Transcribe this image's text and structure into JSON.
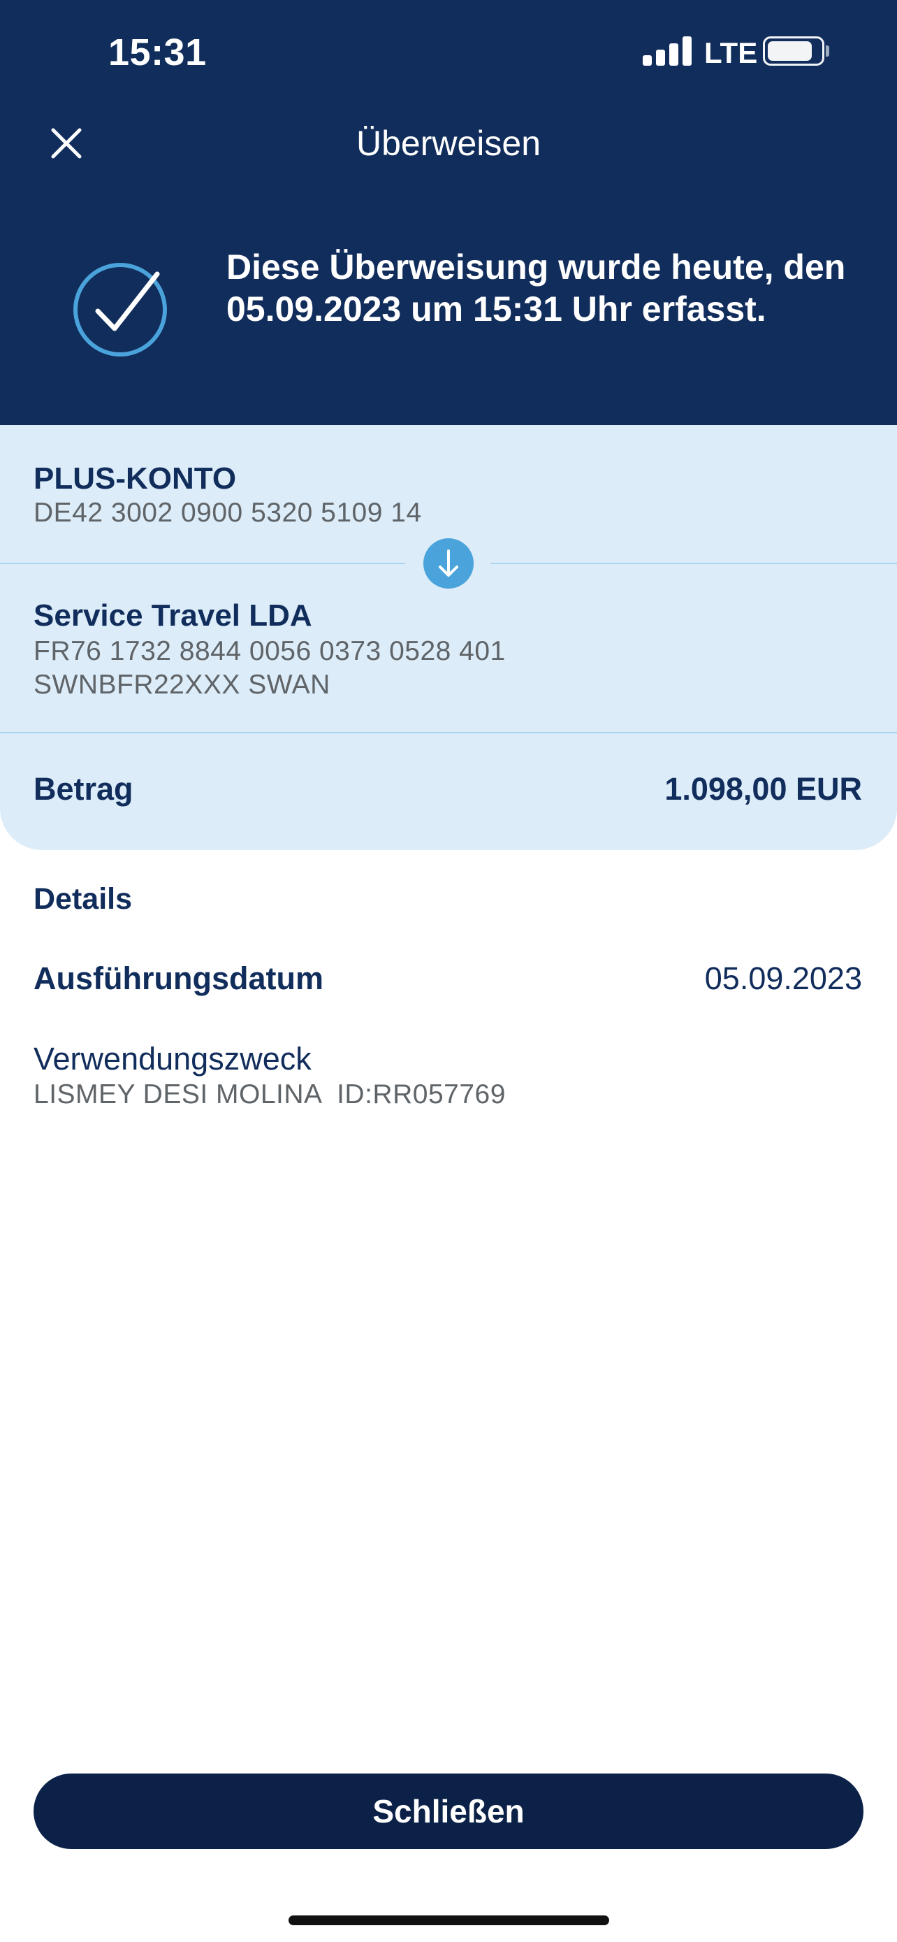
{
  "status_bar": {
    "time": "15:31",
    "network": "LTE",
    "battery_level": 0.85
  },
  "nav": {
    "title": "Überweisen",
    "close_icon": "close-icon"
  },
  "confirmation": {
    "icon": "check-circle-icon",
    "text": "Diese Überweisung wurde heute, den 05.09.2023 um 15:31 Uhr erfasst."
  },
  "sender": {
    "name": "PLUS-KONTO",
    "iban": "DE42 3002 0900 5320 5109 14"
  },
  "recipient": {
    "name": "Service Travel LDA",
    "iban": "FR76 1732 8844 0056 0373 0528 401",
    "bic_bank": "SWNBFR22XXX SWAN"
  },
  "amount": {
    "label": "Betrag",
    "value": "1.098,00 EUR"
  },
  "details": {
    "title": "Details",
    "execution_date_label": "Ausführungsdatum",
    "execution_date_value": "05.09.2023",
    "purpose_label": "Verwendungszweck",
    "purpose_value": "LISMEY DESI MOLINA  ID:RR057769"
  },
  "actions": {
    "close_label": "Schließen"
  },
  "colors": {
    "header_bg": "#112d5c",
    "panel_bg": "#dcecf8",
    "accent": "#4aa3db",
    "button_bg": "#0b2147",
    "text_primary": "#112d5c",
    "text_secondary": "#5f6468"
  }
}
